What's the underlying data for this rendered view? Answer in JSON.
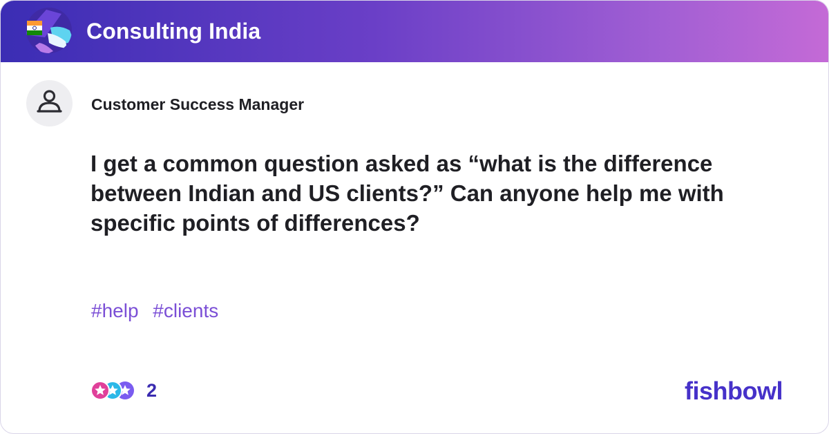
{
  "header": {
    "group_title": "Consulting India",
    "logo_icon": "india-flag-globe-icon"
  },
  "post": {
    "author_role": "Customer Success Manager",
    "avatar_icon": "user-icon",
    "text": "I get a common question asked as “what is the difference between Indian and US clients?” Can anyone help me with specific points of differences?",
    "tags": [
      "#help",
      "#clients"
    ]
  },
  "footer": {
    "reaction_icons": [
      "star-reaction-icon",
      "star-reaction-icon",
      "star-reaction-icon"
    ],
    "reaction_count": "2",
    "brand": "fishbowl"
  },
  "colors": {
    "header_gradient_start": "#3b2db4",
    "header_gradient_end": "#c46ad6",
    "tag_color": "#7b4fd6",
    "brand_color": "#4631c9",
    "count_color": "#3a2bb0"
  }
}
